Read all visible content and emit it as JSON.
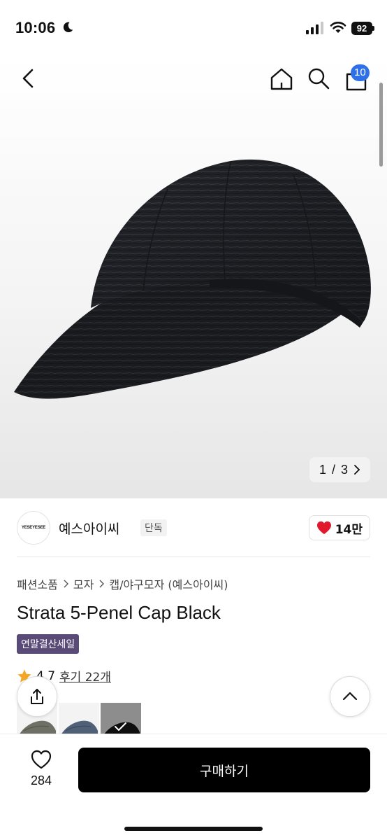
{
  "status_bar": {
    "time": "10:06",
    "battery": "92"
  },
  "header": {
    "cart_count": "10"
  },
  "gallery": {
    "current": "1",
    "separator": "/",
    "total": "3"
  },
  "brand": {
    "logo_text": "YESEYESEE",
    "name": "예스아이씨",
    "tag": "단독",
    "likes": "14만"
  },
  "breadcrumb": [
    "패션소품",
    "모자",
    "캡/야구모자 (예스아이씨)"
  ],
  "product": {
    "title": "Strata 5-Penel Cap Black",
    "sale_badge": "연말결산세일"
  },
  "rating": {
    "score": "4.7",
    "reviews": "후기 22개"
  },
  "bottom_bar": {
    "wish_count": "284",
    "buy_label": "구매하기"
  },
  "colors": {
    "accent": "#2f6fe8",
    "sale_badge": "#5a4a78",
    "heart": "#e1192c",
    "star": "#f5a623",
    "buy_button": "#000000"
  }
}
